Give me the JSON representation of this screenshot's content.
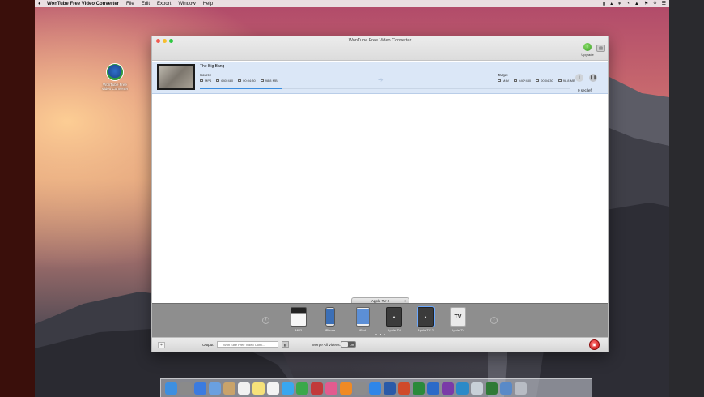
{
  "menubar": {
    "app_name": "WonTube Free Video Converter",
    "menus": [
      "File",
      "Edit",
      "Export",
      "Window",
      "Help"
    ],
    "status_icons": [
      "battery-icon",
      "volume-icon",
      "bluetooth-icon",
      "time-machine-icon",
      "wifi-icon",
      "flag-icon",
      "search-icon",
      "list-icon"
    ]
  },
  "desktop_icon": {
    "label": "WonTube Free Video Converter"
  },
  "window": {
    "title": "WonTube Free Video Converter",
    "upgrade_label": "Upgrade"
  },
  "task": {
    "name": "The Big Bang",
    "source_label": "Source",
    "target_label": "Target",
    "source_meta": [
      "MP4",
      "640*480",
      "00:04:30",
      "98.8 MB"
    ],
    "target_meta": [
      "M4V",
      "640*480",
      "00:04:30",
      "98.8 MB"
    ],
    "progress": 0.22,
    "time_left": "0 sec left"
  },
  "tray": {
    "tab_label": "Apple TV 2",
    "devices": [
      {
        "label": "MP3",
        "icon": "mp3-player-icon"
      },
      {
        "label": "iPhone",
        "icon": "iphone-icon"
      },
      {
        "label": "iPad",
        "icon": "ipad-icon"
      },
      {
        "label": "Apple TV",
        "icon": "apple-tv-icon"
      },
      {
        "label": "Apple TV 2",
        "icon": "apple-tv-2-icon",
        "selected": true
      },
      {
        "label": "Apple TV",
        "icon": "apple-tv-3-icon"
      }
    ],
    "page_dots": 3,
    "active_dot": 1
  },
  "bottom": {
    "output_label": "Output:",
    "output_value": "WonTube Free Video Conv...",
    "merge_label": "Merge All Videos:",
    "toggle_value": "Off"
  },
  "dock": {
    "items": [
      "finder-icon",
      "launchpad-icon",
      "safari-icon",
      "mail-icon",
      "contacts-icon",
      "calendar-icon",
      "notes-icon",
      "reminders-icon",
      "messages-icon",
      "facetime-icon",
      "photo-booth-icon",
      "itunes-icon",
      "ibooks-icon",
      "system-preferences-icon",
      "app-store-icon",
      "word-icon",
      "powerpoint-icon",
      "excel-icon",
      "outlook-icon",
      "onenote-icon",
      "lync-icon",
      "preview-icon",
      "wontube-icon",
      "downloads-icon",
      "trash-icon"
    ],
    "colors": [
      "#3d8fe0",
      "#8a8a8a",
      "#3b7be0",
      "#6aa0e0",
      "#c9a36a",
      "#f1f1f1",
      "#f6e27a",
      "#f3f3f3",
      "#39a7f0",
      "#3aa84a",
      "#c23a3a",
      "#e35b8f",
      "#f08a24",
      "#8c8c8c",
      "#2f86e8",
      "#2a5aa8",
      "#d04a2a",
      "#2a8a3a",
      "#2a6ac8",
      "#7a3aa8",
      "#2a8ac8",
      "#c8d0d8",
      "#2f7a36",
      "#5a8ac8",
      "#b8bcc4"
    ]
  }
}
